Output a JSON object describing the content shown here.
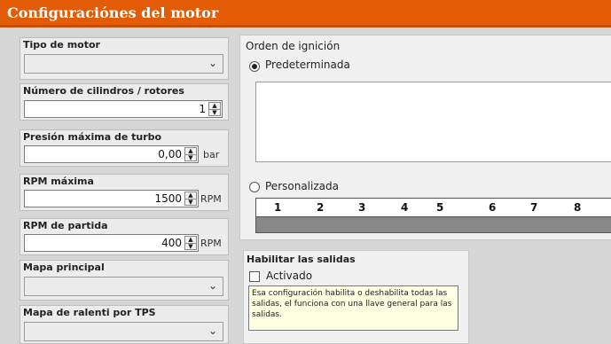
{
  "window": {
    "title": "Configuraciónes del motor"
  },
  "engine_type": {
    "label": "Tipo de motor",
    "value": ""
  },
  "cylinders": {
    "label": "Número de cilindros / rotores",
    "value": "1"
  },
  "max_turbo": {
    "label": "Presión máxima de turbo",
    "value": "0,00",
    "unit": "bar"
  },
  "max_rpm": {
    "label": "RPM máxima",
    "value": "1500",
    "unit": "RPM"
  },
  "start_rpm": {
    "label": "RPM de partida",
    "value": "400",
    "unit": "RPM"
  },
  "main_map": {
    "label": "Mapa principal",
    "value": ""
  },
  "idle_map": {
    "label": "Mapa de ralenti por TPS",
    "value": ""
  },
  "ignition": {
    "title": "Orden de ignición",
    "default_label": "Predeterminada",
    "custom_label": "Personalizada",
    "selected": "Predeterminada",
    "cylinders": [
      "1",
      "2",
      "3",
      "4",
      "5",
      "6",
      "7",
      "8"
    ]
  },
  "outputs": {
    "title": "Habilitar las salidas",
    "checkbox_label": "Activado",
    "checked": false,
    "tooltip": "Esa configuración habilita o deshabilita todas las salidas, el funciona con una llave general para las salidas."
  }
}
